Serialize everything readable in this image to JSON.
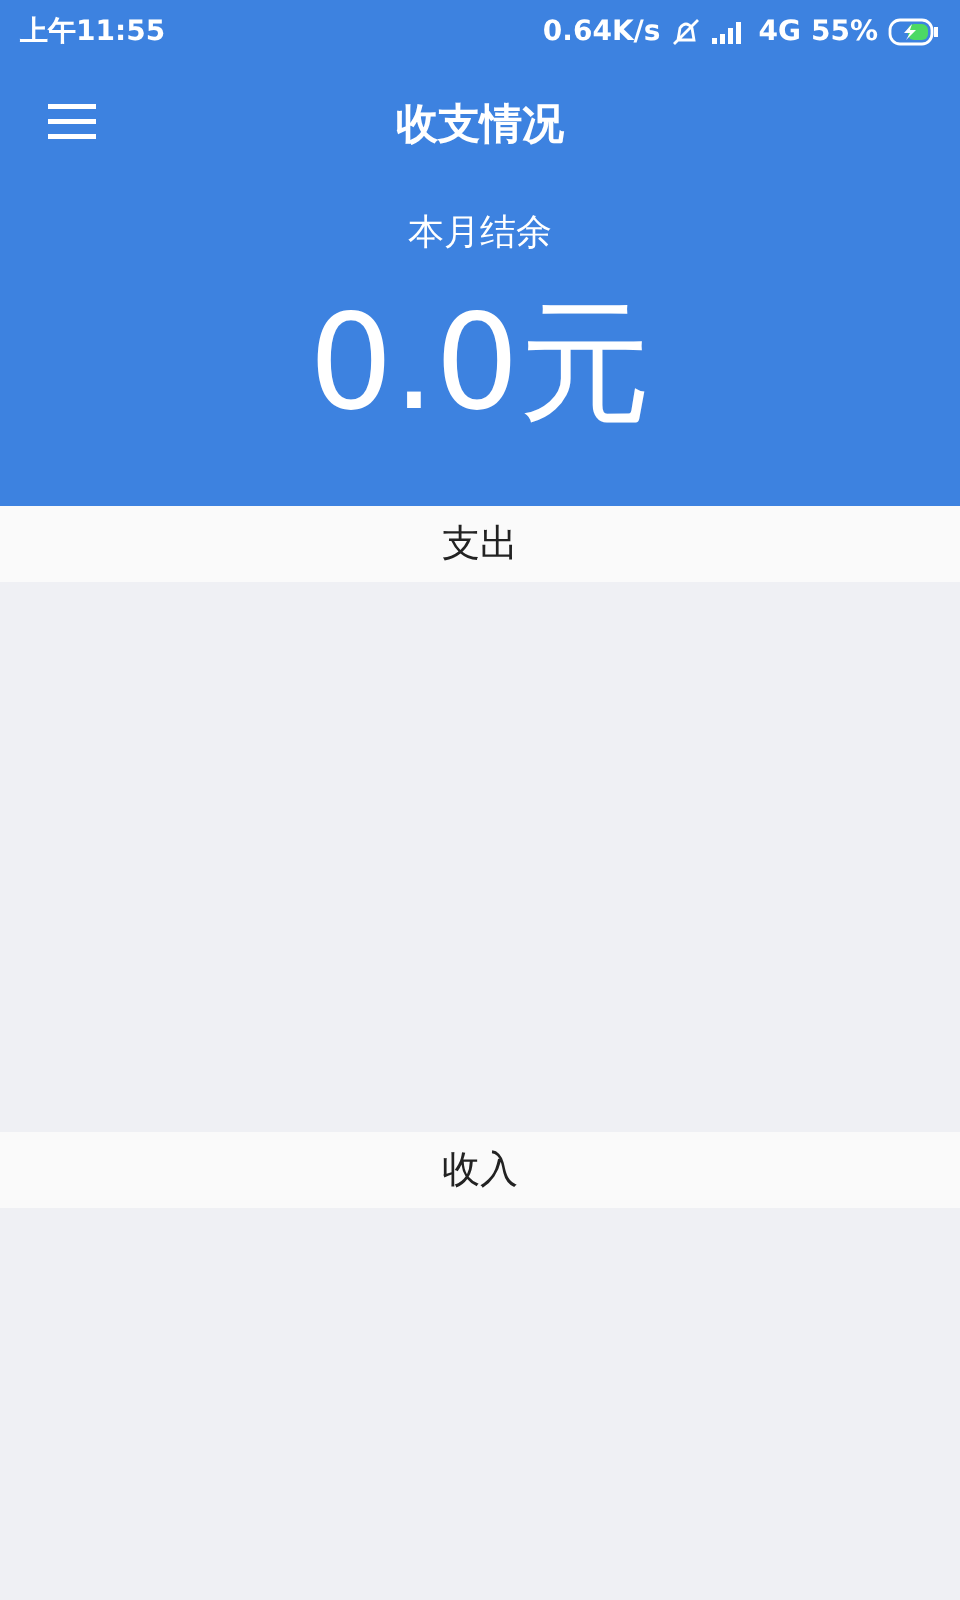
{
  "status_bar": {
    "time": "上午11:55",
    "speed": "0.64K/s",
    "network": "4G",
    "battery": "55%"
  },
  "app_bar": {
    "title": "收支情况"
  },
  "summary": {
    "label": "本月结余",
    "amount": "0.0元"
  },
  "sections": [
    {
      "title": "支出"
    },
    {
      "title": "收入"
    }
  ]
}
